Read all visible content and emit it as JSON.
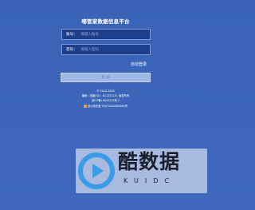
{
  "page": {
    "title": "嘟管家数据信息平台"
  },
  "form": {
    "account_label": "账号：",
    "account_value": "",
    "account_placeholder": "请输入账号",
    "password_label": "密码：",
    "password_value": "",
    "password_placeholder": "请输入密码",
    "auto_login": "自动登录",
    "login_button": "登 录"
  },
  "footer": {
    "copyright": "© 2010-2020",
    "contact": "编辑（电脑/QQ：61132115）版权所有",
    "icp": "浙ICP备19034233号-1",
    "police": "浙公网安备 33070202000962号"
  },
  "watermark": {
    "brand": "酷数据",
    "sub": "KUIDC",
    "logo_color": "#3b9be8"
  }
}
